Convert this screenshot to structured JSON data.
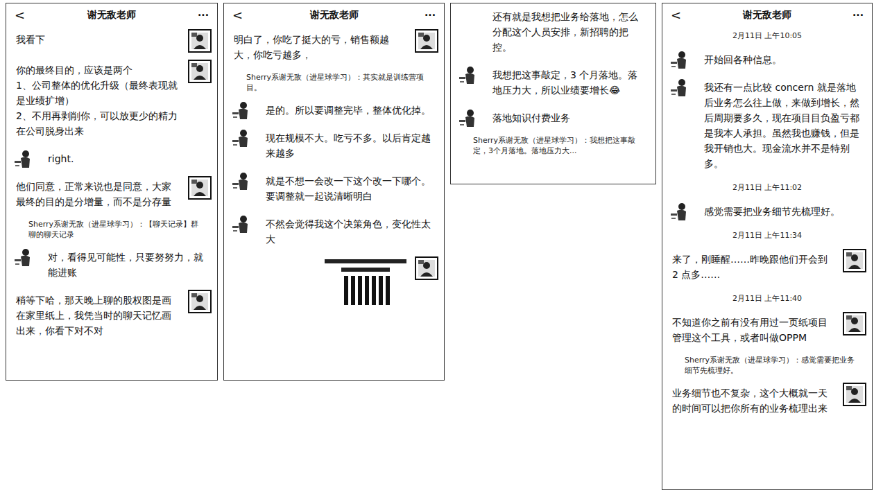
{
  "panels": [
    {
      "header": {
        "back": "<",
        "title": "谢无敌老师",
        "more": "···"
      },
      "messages": [
        {
          "kind": "text",
          "side": "right",
          "avatar": true,
          "text": "我看下"
        },
        {
          "kind": "text",
          "side": "right",
          "avatar": true,
          "text": "你的最终目的，应该是两个\n1、公司整体的优化升级（最终表现就是业绩扩增）\n2、不用再剥削你，可以放更少的精力在公司脱身出来"
        },
        {
          "kind": "text",
          "side": "left",
          "avatar": true,
          "text": "right."
        },
        {
          "kind": "text",
          "side": "right",
          "avatar": true,
          "text": "他们同意，正常来说也是同意，大家最终的目的是分增量，而不是分存量"
        },
        {
          "kind": "quote",
          "side": "left",
          "avatar": false,
          "text": "Sherry系谢无敌（进星球学习）：【聊天记录】群聊的聊天记录"
        },
        {
          "kind": "text",
          "side": "left",
          "avatar": true,
          "text": "对，看得见可能性，只要努努力，就能进账"
        },
        {
          "kind": "text",
          "side": "right",
          "avatar": true,
          "text": "稍等下哈，那天晚上聊的股权图是画在家里纸上，我凭当时的聊天记忆画出来，你看下对不对"
        }
      ]
    },
    {
      "header": {
        "back": "<",
        "title": "谢无敌老师",
        "more": "···"
      },
      "messages": [
        {
          "kind": "text",
          "side": "right",
          "avatar": true,
          "text": "明白了，你吃了挺大的亏，销售额越大，你吃亏越多，"
        },
        {
          "kind": "quote",
          "side": "left",
          "avatar": false,
          "text": "Sherry系谢无敌（进星球学习）：其实就是训练营项目。"
        },
        {
          "kind": "text",
          "side": "left",
          "avatar": true,
          "text": "是的。所以要调整完毕，整体优化掉。"
        },
        {
          "kind": "text",
          "side": "left",
          "avatar": true,
          "text": "现在规模不大。吃亏不多。以后肯定越来越多"
        },
        {
          "kind": "text",
          "side": "left",
          "avatar": true,
          "text": "就是不想一会改一下这个改一下哪个。要调整就一起说清晰明白"
        },
        {
          "kind": "text",
          "side": "left",
          "avatar": true,
          "text": "不然会觉得我这个决策角色，变化性太大"
        },
        {
          "kind": "image",
          "side": "right",
          "avatar": true,
          "text": ""
        }
      ]
    },
    {
      "header": null,
      "messages": [
        {
          "kind": "text",
          "side": "left",
          "avatar": false,
          "text": "还有就是我想把业务给落地，怎么分配这个人员安排，新招聘的把控。"
        },
        {
          "kind": "text",
          "side": "left",
          "avatar": true,
          "text": "我想把这事敲定，3 个月落地。落地压力大，所以业绩要增长😂"
        },
        {
          "kind": "text",
          "side": "left",
          "avatar": true,
          "text": "落地知识付费业务"
        },
        {
          "kind": "quote",
          "side": "left",
          "avatar": false,
          "text": "Sherry系谢无敌（进星球学习）：我想把这事敲定，3个月落地。落地压力大..."
        }
      ]
    },
    {
      "header": {
        "back": "<",
        "title": "谢无敌老师",
        "more": "···"
      },
      "messages": [
        {
          "kind": "time",
          "side": "center",
          "avatar": false,
          "text": "2月11日 上午10:05"
        },
        {
          "kind": "text",
          "side": "left",
          "avatar": true,
          "text": "开始回各种信息。"
        },
        {
          "kind": "text",
          "side": "left",
          "avatar": true,
          "text": "我还有一点比较 concern 就是落地后业务怎么往上做，来做到增长，然后周期要多久，现在项目目负盈亏都是我本人承担。虽然我也赚钱，但是我开销也大。现金流水并不是特别多。"
        },
        {
          "kind": "time",
          "side": "center",
          "avatar": false,
          "text": "2月11日 上午11:02"
        },
        {
          "kind": "text",
          "side": "left",
          "avatar": true,
          "text": "感觉需要把业务细节先梳理好。"
        },
        {
          "kind": "time",
          "side": "center",
          "avatar": false,
          "text": "2月11日 上午11:34"
        },
        {
          "kind": "text",
          "side": "right",
          "avatar": true,
          "text": "来了，刚睡醒……昨晚跟他们开会到 2 点多……"
        },
        {
          "kind": "time",
          "side": "center",
          "avatar": false,
          "text": "2月11日 上午11:40"
        },
        {
          "kind": "text",
          "side": "right",
          "avatar": true,
          "text": "不知道你之前有没有用过一页纸项目管理这个工具，或者叫做OPPM"
        },
        {
          "kind": "quote",
          "side": "left",
          "avatar": false,
          "text": "Sherry系谢无敌（进星球学习）：感觉需要把业务细节先梳理好。"
        },
        {
          "kind": "text",
          "side": "right",
          "avatar": true,
          "text": "业务细节也不复杂，这个大概就一天的时间可以把你所有的业务梳理出来"
        }
      ]
    }
  ]
}
